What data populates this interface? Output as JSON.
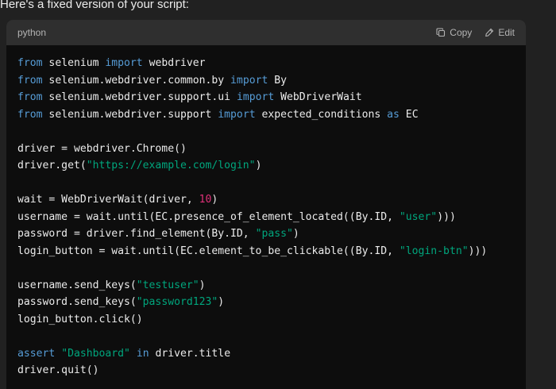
{
  "intro_text": "Here's a fixed version of your script:",
  "code_block": {
    "language": "python",
    "copy_label": "Copy",
    "edit_label": "Edit",
    "colors": {
      "keyword": "#569cd6",
      "string": "#00a67d",
      "number": "#df3079",
      "text": "#ececec"
    },
    "lines": [
      [
        {
          "t": "kw",
          "v": "from"
        },
        {
          "t": "txt",
          "v": " selenium "
        },
        {
          "t": "kw",
          "v": "import"
        },
        {
          "t": "txt",
          "v": " webdriver"
        }
      ],
      [
        {
          "t": "kw",
          "v": "from"
        },
        {
          "t": "txt",
          "v": " selenium.webdriver.common.by "
        },
        {
          "t": "kw",
          "v": "import"
        },
        {
          "t": "txt",
          "v": " By"
        }
      ],
      [
        {
          "t": "kw",
          "v": "from"
        },
        {
          "t": "txt",
          "v": " selenium.webdriver.support.ui "
        },
        {
          "t": "kw",
          "v": "import"
        },
        {
          "t": "txt",
          "v": " WebDriverWait"
        }
      ],
      [
        {
          "t": "kw",
          "v": "from"
        },
        {
          "t": "txt",
          "v": " selenium.webdriver.support "
        },
        {
          "t": "kw",
          "v": "import"
        },
        {
          "t": "txt",
          "v": " expected_conditions "
        },
        {
          "t": "kw",
          "v": "as"
        },
        {
          "t": "txt",
          "v": " EC"
        }
      ],
      [],
      [
        {
          "t": "txt",
          "v": "driver = webdriver.Chrome()"
        }
      ],
      [
        {
          "t": "txt",
          "v": "driver.get("
        },
        {
          "t": "str",
          "v": "\"https://example.com/login\""
        },
        {
          "t": "txt",
          "v": ")"
        }
      ],
      [],
      [
        {
          "t": "txt",
          "v": "wait = WebDriverWait(driver, "
        },
        {
          "t": "num",
          "v": "10"
        },
        {
          "t": "txt",
          "v": ")"
        }
      ],
      [
        {
          "t": "txt",
          "v": "username = wait.until(EC.presence_of_element_located((By.ID, "
        },
        {
          "t": "str",
          "v": "\"user\""
        },
        {
          "t": "txt",
          "v": ")))"
        }
      ],
      [
        {
          "t": "txt",
          "v": "password = driver.find_element(By.ID, "
        },
        {
          "t": "str",
          "v": "\"pass\""
        },
        {
          "t": "txt",
          "v": ")"
        }
      ],
      [
        {
          "t": "txt",
          "v": "login_button = wait.until(EC.element_to_be_clickable((By.ID, "
        },
        {
          "t": "str",
          "v": "\"login-btn\""
        },
        {
          "t": "txt",
          "v": ")))"
        }
      ],
      [],
      [
        {
          "t": "txt",
          "v": "username.send_keys("
        },
        {
          "t": "str",
          "v": "\"testuser\""
        },
        {
          "t": "txt",
          "v": ")"
        }
      ],
      [
        {
          "t": "txt",
          "v": "password.send_keys("
        },
        {
          "t": "str",
          "v": "\"password123\""
        },
        {
          "t": "txt",
          "v": ")"
        }
      ],
      [
        {
          "t": "txt",
          "v": "login_button.click()"
        }
      ],
      [],
      [
        {
          "t": "kw",
          "v": "assert"
        },
        {
          "t": "txt",
          "v": " "
        },
        {
          "t": "str",
          "v": "\"Dashboard\""
        },
        {
          "t": "txt",
          "v": " "
        },
        {
          "t": "kw",
          "v": "in"
        },
        {
          "t": "txt",
          "v": " driver.title"
        }
      ],
      [
        {
          "t": "txt",
          "v": "driver.quit()"
        }
      ]
    ]
  },
  "icons": {
    "copy": "copy-icon",
    "edit": "edit-pencil-icon"
  }
}
